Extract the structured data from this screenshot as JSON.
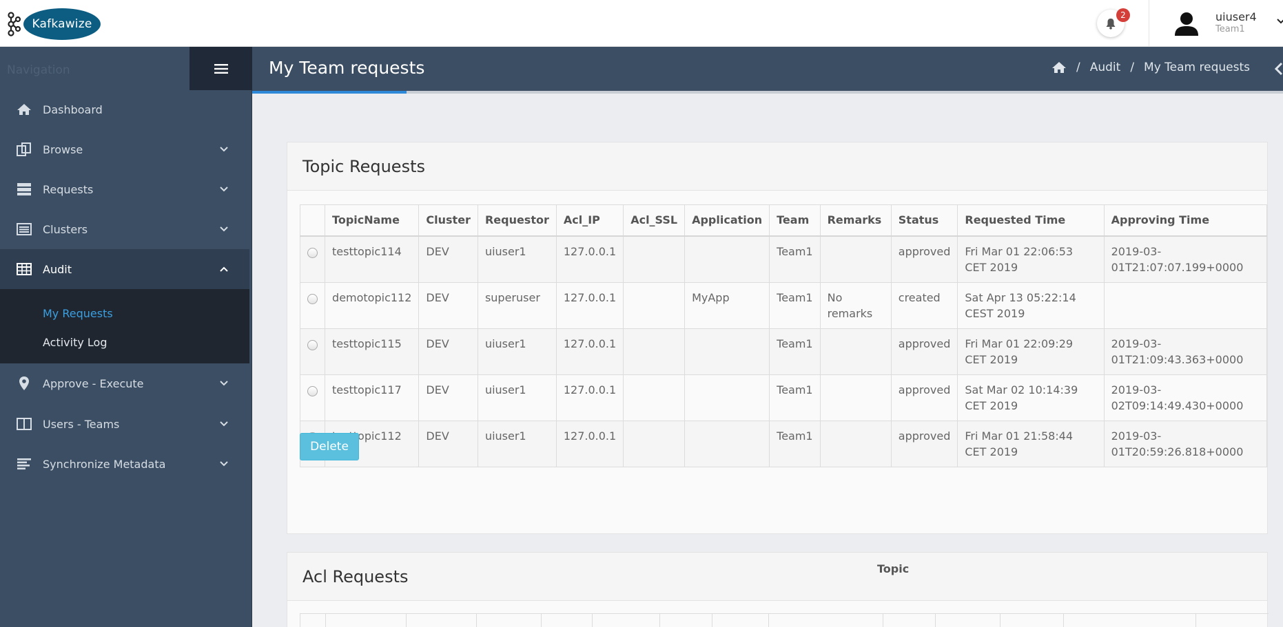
{
  "app": {
    "brand": "Kafkawize"
  },
  "header": {
    "notification_count": "2",
    "user_name": "uiuser4",
    "user_team": "Team1"
  },
  "sidebar": {
    "title": "Navigation",
    "items": [
      {
        "label": "Dashboard",
        "icon": "home-icon"
      },
      {
        "label": "Browse",
        "icon": "copy-icon"
      },
      {
        "label": "Requests",
        "icon": "server-icon"
      },
      {
        "label": "Clusters",
        "icon": "list-icon"
      },
      {
        "label": "Audit",
        "icon": "table-icon"
      },
      {
        "label": "Approve - Execute",
        "icon": "map-marker-icon"
      },
      {
        "label": "Users - Teams",
        "icon": "columns-icon"
      },
      {
        "label": "Synchronize Metadata",
        "icon": "align-left-icon"
      }
    ],
    "audit_sub": [
      "My Requests",
      "Activity Log"
    ]
  },
  "page": {
    "title": "My Team requests",
    "breadcrumb": [
      "Audit",
      "My Team requests"
    ],
    "progress_fraction": 0.15
  },
  "topic_panel": {
    "title": "Topic Requests",
    "columns": [
      "",
      "TopicName",
      "Cluster",
      "Requestor",
      "Acl_IP",
      "Acl_SSL",
      "Application",
      "Team",
      "Remarks",
      "Status",
      "Requested Time",
      "Approving Time"
    ],
    "rows": [
      [
        "testtopic114",
        "DEV",
        "uiuser1",
        "127.0.0.1",
        "",
        "",
        "Team1",
        "",
        "approved",
        "Fri Mar 01 22:06:53 CET 2019",
        "2019-03-01T21:07:07.199+0000"
      ],
      [
        "demotopic112",
        "DEV",
        "superuser",
        "127.0.0.1",
        "",
        "MyApp",
        "Team1",
        "No remarks",
        "created",
        "Sat Apr 13 05:22:14 CEST 2019",
        ""
      ],
      [
        "testtopic115",
        "DEV",
        "uiuser1",
        "127.0.0.1",
        "",
        "",
        "Team1",
        "",
        "approved",
        "Fri Mar 01 22:09:29 CET 2019",
        "2019-03-01T21:09:43.363+0000"
      ],
      [
        "testtopic117",
        "DEV",
        "uiuser1",
        "127.0.0.1",
        "",
        "",
        "Team1",
        "",
        "approved",
        "Sat Mar 02 10:14:39 CET 2019",
        "2019-03-02T09:14:49.430+0000"
      ],
      [
        "testtopic112",
        "DEV",
        "uiuser1",
        "127.0.0.1",
        "",
        "",
        "Team1",
        "",
        "approved",
        "Fri Mar 01 21:58:44 CET 2019",
        "2019-03-01T20:59:26.818+0000"
      ]
    ],
    "delete_label": "Delete"
  },
  "acl_panel": {
    "title": "Acl Requests",
    "peek_header": "Topic"
  }
}
